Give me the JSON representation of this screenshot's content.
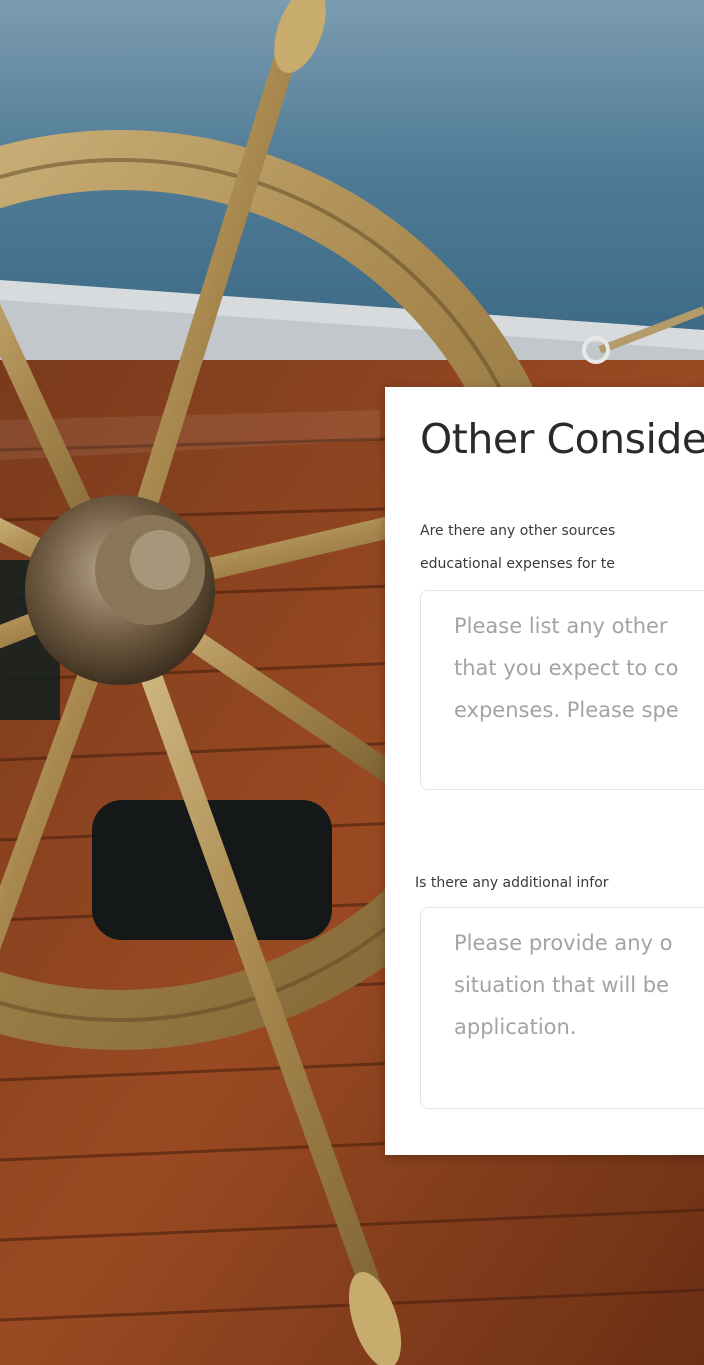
{
  "form": {
    "section_title": "Other Conside",
    "question1": {
      "label_line1": "Are there any other sources",
      "label_line2": "educational expenses for te",
      "placeholder_line1": "Please list any other",
      "placeholder_line2": "that you expect to co",
      "placeholder_line3": "expenses. Please spe"
    },
    "question2": {
      "label": "Is there any additional infor",
      "placeholder_line1": "Please provide any o",
      "placeholder_line2": "situation that will be",
      "placeholder_line3": "application."
    }
  },
  "colors": {
    "card_background": "#ffffff",
    "title_text": "#2a2a2a",
    "label_text": "#3a3a3a",
    "placeholder_text": "#a3a3a3",
    "field_border": "#e3e3e3"
  },
  "background_image": {
    "subject": "ship-steering-wheel-photo"
  }
}
